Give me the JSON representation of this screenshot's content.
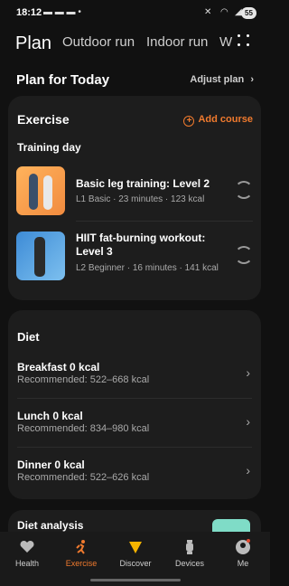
{
  "status_bar": {
    "time": "18:12",
    "battery": "55"
  },
  "tabs": [
    {
      "label": "Plan"
    },
    {
      "label": "Outdoor run"
    },
    {
      "label": "Indoor run"
    },
    {
      "label": "W"
    }
  ],
  "plan": {
    "title": "Plan for Today",
    "adjust_label": "Adjust plan",
    "adjust_chevron": ">"
  },
  "exercise": {
    "title": "Exercise",
    "add_label": "Add course",
    "day_label": "Training day",
    "courses": [
      {
        "name": "Basic leg training: Level 2",
        "meta": "L1 Basic · 23 minutes · 123 kcal"
      },
      {
        "name": "HIIT fat-burning workout: Level 3",
        "meta": "L2 Beginner · 16 minutes · 141 kcal"
      }
    ]
  },
  "diet": {
    "title": "Diet",
    "meals": [
      {
        "name": "Breakfast 0 kcal",
        "recommended": "Recommended: 522–668 kcal"
      },
      {
        "name": "Lunch 0 kcal",
        "recommended": "Recommended: 834–980 kcal"
      },
      {
        "name": "Dinner 0 kcal",
        "recommended": "Recommended: 522–626 kcal"
      }
    ]
  },
  "diet_analysis": {
    "title": "Diet analysis"
  },
  "nav": [
    {
      "label": "Health",
      "icon": "heart-pulse-icon"
    },
    {
      "label": "Exercise",
      "icon": "running-icon"
    },
    {
      "label": "Discover",
      "icon": "discover-icon"
    },
    {
      "label": "Devices",
      "icon": "watch-icon"
    },
    {
      "label": "Me",
      "icon": "profile-icon"
    }
  ],
  "colors": {
    "accent": "#f07a2e",
    "background": "#111111",
    "card": "#1d1d1d"
  }
}
